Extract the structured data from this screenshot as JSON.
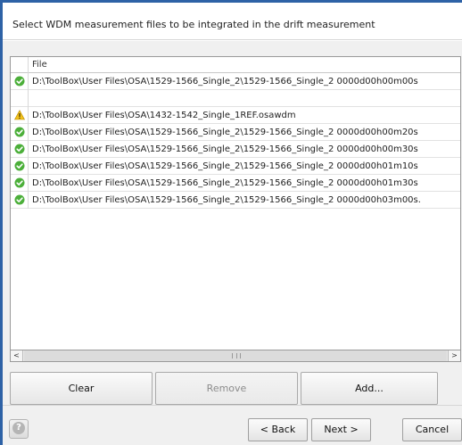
{
  "header": {
    "instruction": "Select WDM measurement files to be integrated in the drift measurement"
  },
  "file_list": {
    "column_header": "File",
    "rows": [
      {
        "status": "ok",
        "icon": "check-circle-icon",
        "path": "D:\\ToolBox\\User Files\\OSA\\1529-1566_Single_2\\1529-1566_Single_2 0000d00h00m00s"
      },
      {
        "status": "empty",
        "icon": "",
        "path": ""
      },
      {
        "status": "warning",
        "icon": "warning-triangle-icon",
        "path": "D:\\ToolBox\\User Files\\OSA\\1432-1542_Single_1REF.osawdm"
      },
      {
        "status": "ok",
        "icon": "check-circle-icon",
        "path": "D:\\ToolBox\\User Files\\OSA\\1529-1566_Single_2\\1529-1566_Single_2 0000d00h00m20s"
      },
      {
        "status": "ok",
        "icon": "check-circle-icon",
        "path": "D:\\ToolBox\\User Files\\OSA\\1529-1566_Single_2\\1529-1566_Single_2 0000d00h00m30s"
      },
      {
        "status": "ok",
        "icon": "check-circle-icon",
        "path": "D:\\ToolBox\\User Files\\OSA\\1529-1566_Single_2\\1529-1566_Single_2 0000d00h01m10s"
      },
      {
        "status": "ok",
        "icon": "check-circle-icon",
        "path": "D:\\ToolBox\\User Files\\OSA\\1529-1566_Single_2\\1529-1566_Single_2 0000d00h01m30s"
      },
      {
        "status": "ok",
        "icon": "check-circle-icon",
        "path": "D:\\ToolBox\\User Files\\OSA\\1529-1566_Single_2\\1529-1566_Single_2 0000d00h03m00s."
      }
    ]
  },
  "scrollbar": {
    "left_arrow": "<",
    "right_arrow": ">",
    "left_icon": "scroll-left-icon",
    "right_icon": "scroll-right-icon"
  },
  "actions": {
    "clear_label": "Clear",
    "remove_label": "Remove",
    "add_label": "Add..."
  },
  "footer": {
    "help_icon": "help-icon",
    "help_glyph": "?",
    "back_label": "< Back",
    "next_label": "Next >",
    "cancel_label": "Cancel"
  },
  "colors": {
    "accent_border": "#2e62a6",
    "ok_green": "#4caf3a",
    "warning_yellow": "#f2c21b"
  }
}
